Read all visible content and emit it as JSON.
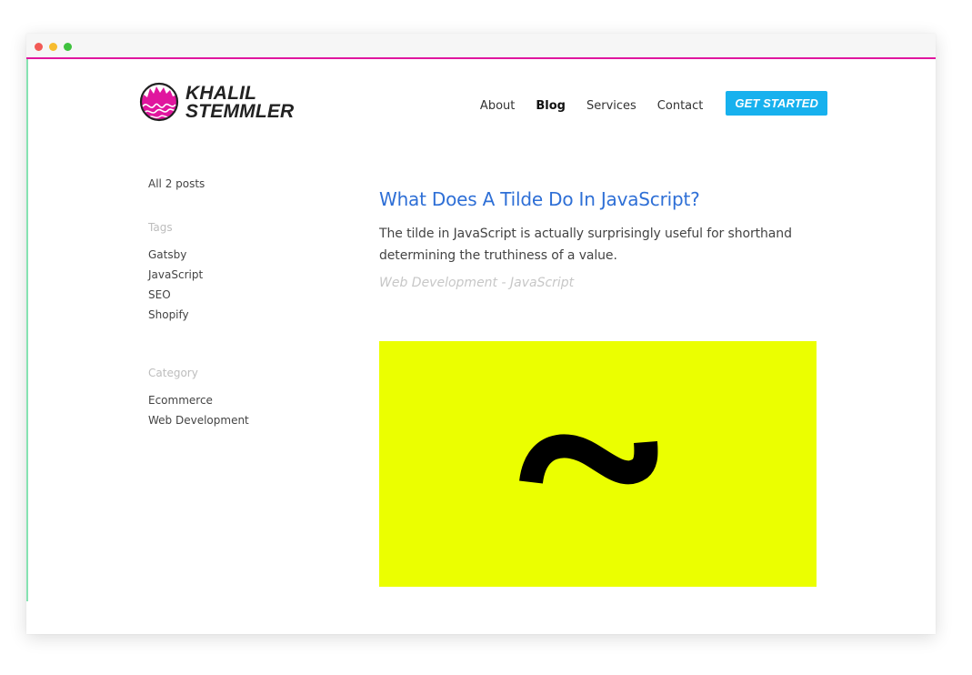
{
  "window": {
    "traffic_lights": [
      "close",
      "minimize",
      "maximize"
    ],
    "accent_color": "#e0169e"
  },
  "header": {
    "logo": {
      "line1": "KHALIL",
      "line2": "STEMMLER"
    },
    "nav": [
      {
        "label": "About",
        "active": false
      },
      {
        "label": "Blog",
        "active": true
      },
      {
        "label": "Services",
        "active": false
      },
      {
        "label": "Contact",
        "active": false
      }
    ],
    "cta_label": "GET STARTED",
    "cta_color": "#17b1ee"
  },
  "sidebar": {
    "all_posts": "All 2 posts",
    "tags_heading": "Tags",
    "tags": [
      "Gatsby",
      "JavaScript",
      "SEO",
      "Shopify"
    ],
    "category_heading": "Category",
    "categories": [
      "Ecommerce",
      "Web Development"
    ]
  },
  "post": {
    "title": "What Does A Tilde Do In JavaScript?",
    "excerpt": "The tilde in JavaScript is actually surprisingly useful for shorthand determining the truthiness of a value.",
    "meta": "Web Development - JavaScript",
    "image": {
      "icon": "tilde-icon",
      "background": "#ebff00"
    }
  }
}
